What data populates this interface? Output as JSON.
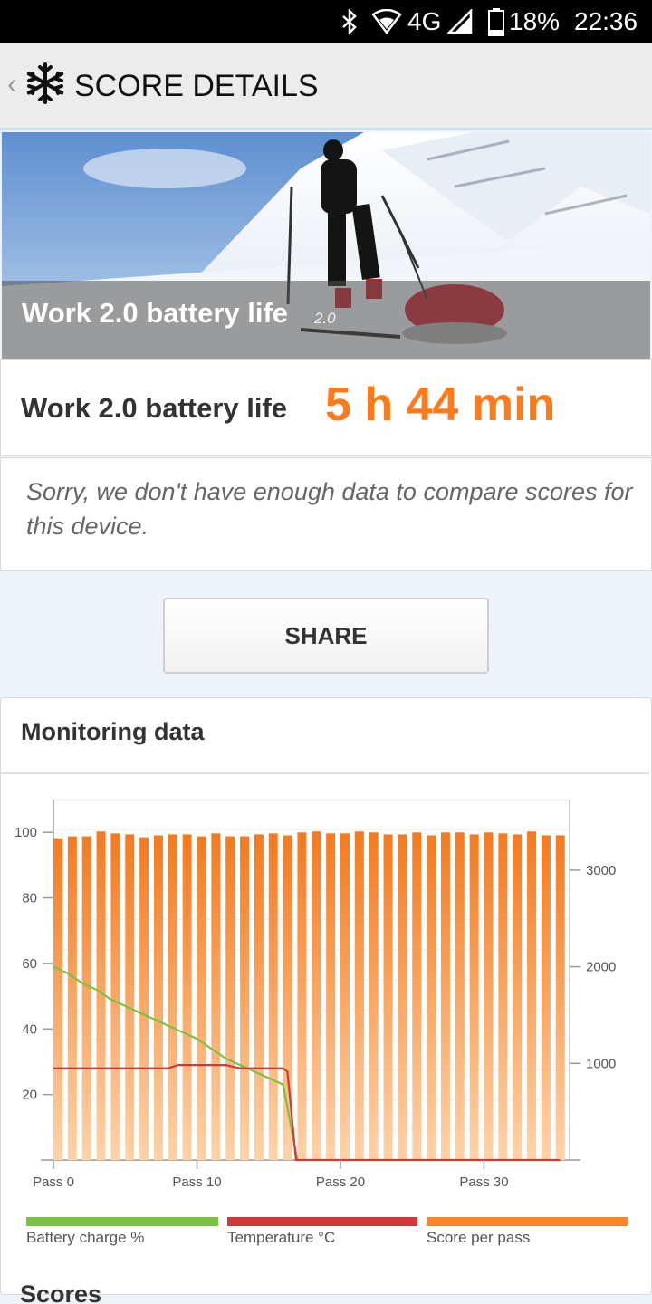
{
  "status_bar": {
    "network": "4G",
    "battery": "18%",
    "time": "22:36"
  },
  "app_bar": {
    "back": "‹",
    "title": "SCORE DETAILS"
  },
  "hero": {
    "title": "Work 2.0 battery life",
    "version": "2.0"
  },
  "result": {
    "label": "Work 2.0 battery life",
    "value": "5 h 44 min"
  },
  "notice": "Sorry, we don't have enough data to compare scores for this device.",
  "share_label": "SHARE",
  "monitoring": {
    "title": "Monitoring data",
    "legend": [
      {
        "label": "Battery charge %",
        "color": "#7ac143"
      },
      {
        "label": "Temperature °C",
        "color": "#d0393a"
      },
      {
        "label": "Score per pass",
        "color": "#f5862a"
      }
    ]
  },
  "scores_heading": "Scores",
  "chart_data": {
    "type": "bar",
    "left_axis": {
      "ticks": [
        20,
        40,
        60,
        80,
        100
      ],
      "range": [
        0,
        110
      ]
    },
    "right_axis": {
      "ticks": [
        1000,
        2000,
        3000
      ],
      "range": [
        0,
        3730
      ]
    },
    "x_ticks": [
      "Pass 0",
      "Pass 10",
      "Pass 20",
      "Pass 30"
    ],
    "series": [
      {
        "name": "Score per pass",
        "axis": "right",
        "color": "#f5862a",
        "values": [
          3330,
          3350,
          3350,
          3400,
          3380,
          3370,
          3340,
          3360,
          3370,
          3370,
          3350,
          3380,
          3350,
          3350,
          3370,
          3380,
          3360,
          3390,
          3400,
          3380,
          3380,
          3400,
          3390,
          3370,
          3370,
          3390,
          3360,
          3390,
          3390,
          3370,
          3390,
          3380,
          3370,
          3400,
          3360,
          3360
        ]
      },
      {
        "name": "Battery charge %",
        "axis": "left",
        "color": "#7ac143",
        "points": [
          [
            0,
            59
          ],
          [
            1,
            57
          ],
          [
            2,
            54
          ],
          [
            3,
            52
          ],
          [
            4,
            49
          ],
          [
            5,
            47
          ],
          [
            6,
            45
          ],
          [
            7,
            43
          ],
          [
            8,
            41
          ],
          [
            9,
            39
          ],
          [
            10,
            37
          ],
          [
            11,
            34
          ],
          [
            12,
            31
          ],
          [
            13,
            29
          ],
          [
            14,
            27
          ],
          [
            15,
            25
          ],
          [
            16,
            23
          ],
          [
            17,
            0
          ]
        ]
      },
      {
        "name": "Temperature °C",
        "axis": "left",
        "color": "#d0393a",
        "points": [
          [
            0,
            28
          ],
          [
            8,
            28
          ],
          [
            8.7,
            29
          ],
          [
            12,
            29
          ],
          [
            13,
            28
          ],
          [
            16,
            28
          ],
          [
            16.3,
            27
          ],
          [
            16.9,
            0
          ],
          [
            35.3,
            0
          ]
        ]
      }
    ]
  }
}
